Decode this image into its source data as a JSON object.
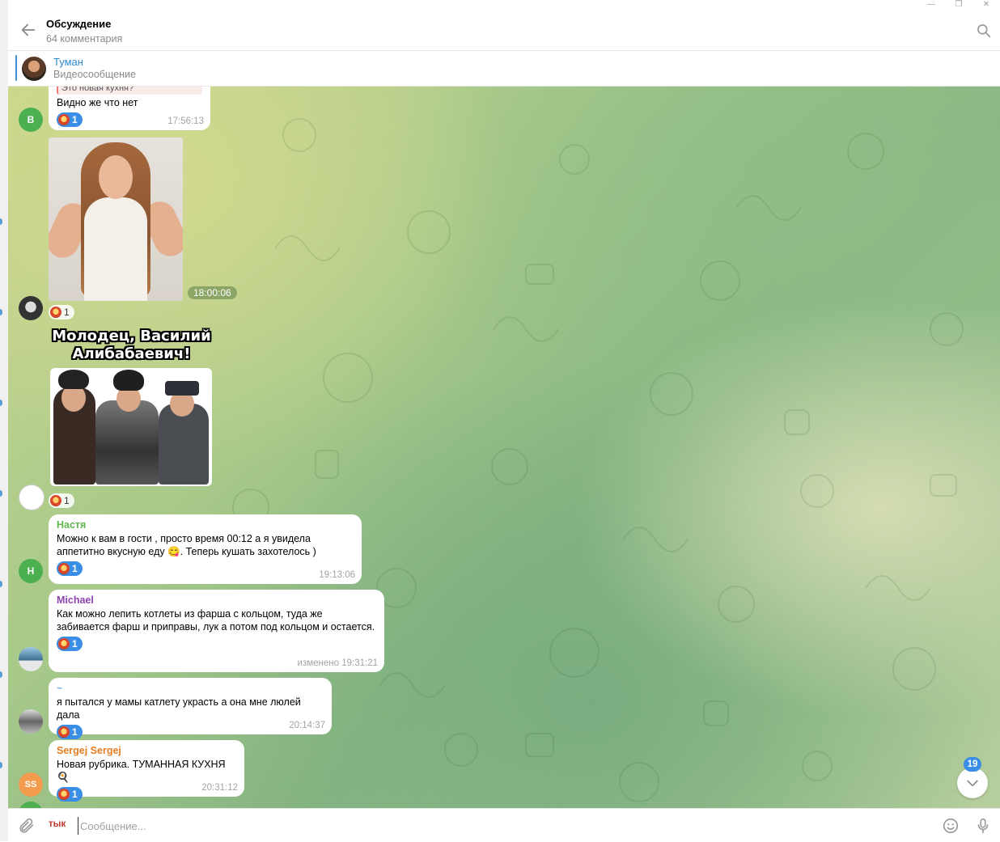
{
  "header": {
    "title": "Обсуждение",
    "subtitle": "64 комментария",
    "back_icon": "arrow-left-icon",
    "search_icon": "search-icon"
  },
  "pinned": {
    "name": "Туман",
    "text": "Видеосообщение"
  },
  "messages": [
    {
      "partial_reply": "Это новая кухня?",
      "text": "Видно же что нет",
      "reaction_count": "1",
      "time": "17:56:13",
      "avatar_letter": "В",
      "avatar_color": "#4caf50"
    },
    {
      "type": "photo",
      "time": "18:00:06",
      "reaction_count": "1"
    },
    {
      "type": "sticker",
      "caption_line1": "Молодец, Василий",
      "caption_line2": "Алибабаевич!",
      "reaction_count": "1"
    },
    {
      "sender": "Настя",
      "sender_color": "#5fb84d",
      "text": "Можно к вам в гости , просто время 00:12 а я увидела аппетитно вкусную еду 😋. Теперь кушать захотелось )",
      "reaction_count": "1",
      "time": "19:13:06",
      "avatar_letter": "Н",
      "avatar_color": "#4caf50"
    },
    {
      "sender": "Michael",
      "sender_color": "#8e44ad",
      "text": "Как можно лепить котлеты из фарша с кольцом, туда же забивается фарш и приправы, лук а потом под кольцом и остается.",
      "reaction_count": "1",
      "time": "изменено 19:31:21"
    },
    {
      "sender": "~",
      "sender_color": "#3a8ee6",
      "text": "я пытался у мамы катлету украсть а она мне люлей дала",
      "reaction_count": "1",
      "time": "20:14:37"
    },
    {
      "sender": "Sergej Sergej",
      "sender_color": "#e67e22",
      "text": "Новая рубрика. ТУМАННАЯ КУХНЯ 🍳",
      "reaction_count": "1",
      "time": "20:31:12",
      "avatar_letter": "SS",
      "avatar_color": "#f39c4d"
    }
  ],
  "scroll": {
    "unread_count": "19",
    "icon": "chevron-down-icon"
  },
  "composer": {
    "prefix": "тык",
    "placeholder": "Сообщение...",
    "attach_icon": "paperclip-icon",
    "emoji_icon": "smile-icon",
    "mic_icon": "microphone-icon"
  },
  "colors": {
    "accent": "#3a8ee6",
    "reaction_bg": "#3a8ee6"
  }
}
